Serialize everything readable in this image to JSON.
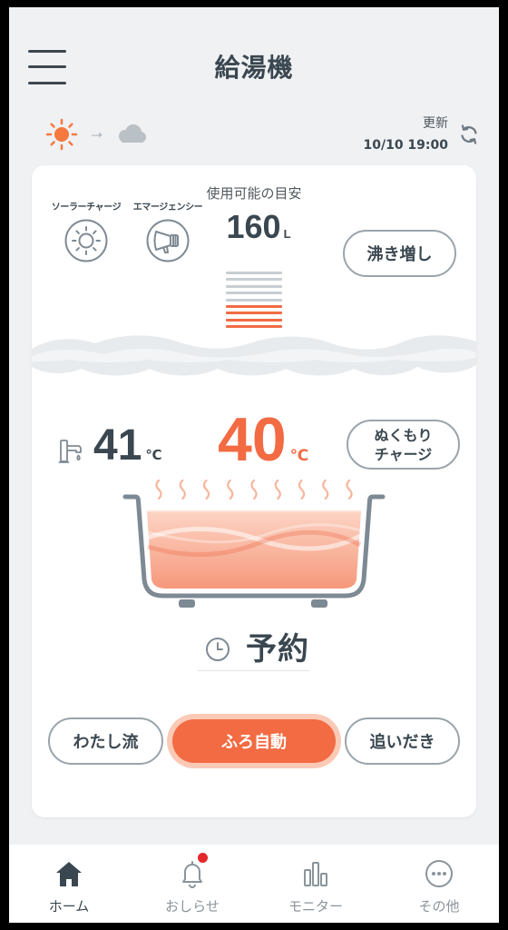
{
  "colors": {
    "accent": "#f26b43",
    "accent_light": "#fbcab7",
    "text": "#3a4750",
    "muted": "#8a949b",
    "line": "#9aa4ab",
    "background": "#f0f1f3",
    "badge": "#e5262b"
  },
  "header": {
    "title": "給湯機",
    "menu_icon": "hamburger-menu-icon"
  },
  "weather": {
    "current_icon": "sun-icon",
    "transition_icon": "arrow-right-icon",
    "forecast_icon": "cloud-icon",
    "update_label": "更新",
    "update_time": "10/10 19:00",
    "refresh_icon": "refresh-icon"
  },
  "tank": {
    "solar_charge_label": "ソーラーチャージ",
    "solar_charge_icon": "sun-outline-icon",
    "emergency_label": "エマージェンシー",
    "emergency_icon": "megaphone-icon",
    "available_label": "使用可能の目安",
    "available_value": "160",
    "available_unit": "L",
    "boost_button": "沸き増し",
    "gauge": {
      "segments": 9,
      "filled": 4
    }
  },
  "bath": {
    "faucet_icon": "faucet-icon",
    "faucet_temp": "41",
    "faucet_unit": "℃",
    "bath_temp": "40",
    "bath_unit": "℃",
    "warmth_charge_button": {
      "line1": "ぬくもり",
      "line2": "チャージ"
    },
    "tub_icon": "bathtub-icon",
    "reservation_icon": "clock-icon",
    "reservation_label": "予約"
  },
  "modes": [
    {
      "label": "わたし流",
      "active": false
    },
    {
      "label": "ふろ自動",
      "active": true
    },
    {
      "label": "追いだき",
      "active": false
    }
  ],
  "nav": [
    {
      "label": "ホーム",
      "icon": "home-icon",
      "active": true,
      "badge": false
    },
    {
      "label": "おしらせ",
      "icon": "bell-icon",
      "active": false,
      "badge": true
    },
    {
      "label": "モニター",
      "icon": "bar-chart-icon",
      "active": false,
      "badge": false
    },
    {
      "label": "その他",
      "icon": "more-icon",
      "active": false,
      "badge": false
    }
  ]
}
